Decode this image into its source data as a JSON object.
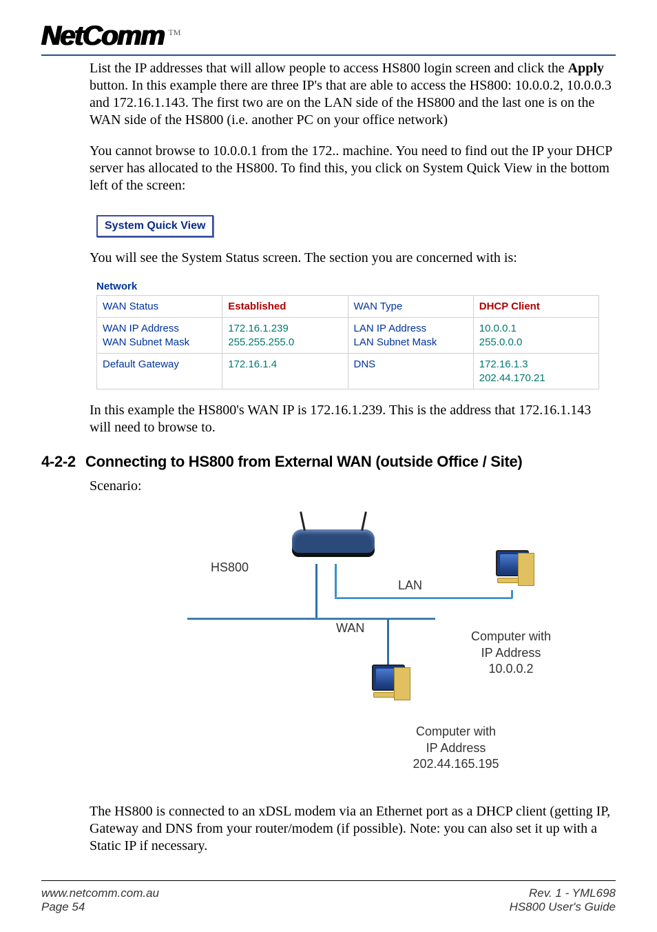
{
  "header": {
    "logo_text": "NetComm",
    "logo_tm": "TM"
  },
  "body": {
    "p1_a": "List the IP addresses that will allow people to access HS800 login screen and click the ",
    "p1_bold": "Apply",
    "p1_b": " button. In this example there are three IP's that are able to access the HS800: 10.0.0.2, 10.0.0.3 and 172.16.1.143. The first two are on the LAN side of the HS800 and the last one is on the WAN side of the HS800 (i.e. another PC on your office network)",
    "p2": "You cannot browse to 10.0.0.1 from the 172.. machine. You need to find out the IP your DHCP server has allocated to the HS800. To find this, you click on System Quick View in the bottom left of the screen:",
    "sqv_button": "System Quick View",
    "p3": "You will see the System Status screen. The section you are concerned with is:",
    "network": {
      "title": "Network",
      "r1c1": "WAN Status",
      "r1c2": "Established",
      "r1c3": "WAN Type",
      "r1c4": "DHCP Client",
      "r2c1a": "WAN IP Address",
      "r2c1b": "WAN Subnet Mask",
      "r2c2a": "172.16.1.239",
      "r2c2b": "255.255.255.0",
      "r2c3a": "LAN IP Address",
      "r2c3b": "LAN Subnet Mask",
      "r2c4a": "10.0.0.1",
      "r2c4b": "255.0.0.0",
      "r3c1": "Default Gateway",
      "r3c2": "172.16.1.4",
      "r3c3": "DNS",
      "r3c4a": "172.16.1.3",
      "r3c4b": "202.44.170.21"
    },
    "p4": "In this example the HS800's WAN IP is 172.16.1.239. This is the address that 172.16.1.143 will need to browse to.",
    "section_num": "4-2-2",
    "section_title": "Connecting to HS800 from External WAN (outside Office / Site)",
    "p5": "Scenario:",
    "diagram": {
      "hs_label": "HS800",
      "lan": "LAN",
      "wan": "WAN",
      "pc_top_l1": "Computer with",
      "pc_top_l2": "IP Address",
      "pc_top_l3": "10.0.0.2",
      "pc_bot_l1": "Computer with",
      "pc_bot_l2": "IP Address",
      "pc_bot_l3": "202.44.165.195"
    },
    "p6": "The HS800 is connected to an xDSL modem via an Ethernet port as a DHCP client (getting IP, Gateway and DNS from your router/modem (if possible). Note: you can also set it up with a Static IP if necessary."
  },
  "footer": {
    "url": "www.netcomm.com.au",
    "page": "Page 54",
    "rev": "Rev. 1 - YML698",
    "guide": "HS800 User's Guide"
  }
}
